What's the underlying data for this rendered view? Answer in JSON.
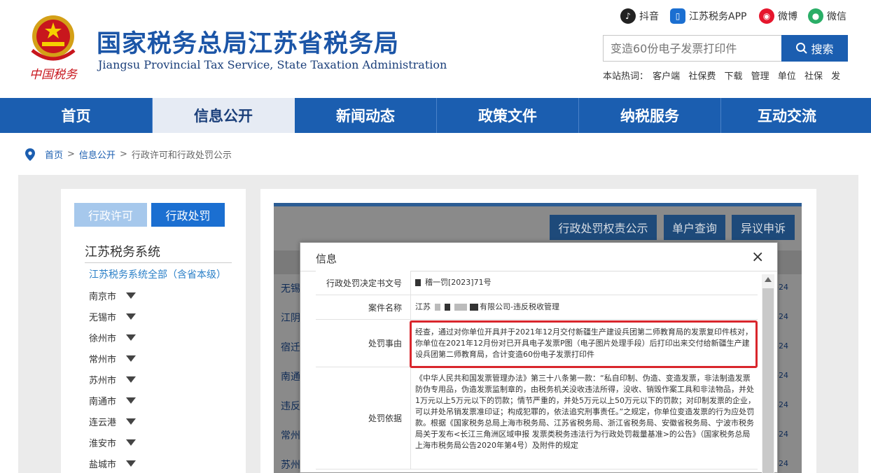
{
  "header": {
    "logo_caption": "中国税务",
    "title": "国家税务总局江苏省税务局",
    "subtitle": "Jiangsu Provincial Tax Service, State Taxation Administration",
    "social": [
      {
        "label": "抖音",
        "icon": "douyin-icon",
        "color": "#222222"
      },
      {
        "label": "江苏税务APP",
        "icon": "app-icon",
        "color": "#1b6fd1"
      },
      {
        "label": "微博",
        "icon": "weibo-icon",
        "color": "#e6162d"
      },
      {
        "label": "微信",
        "icon": "wechat-icon",
        "color": "#2aae67"
      }
    ],
    "search": {
      "placeholder": "变造60份电子发票打印件",
      "button": "搜索"
    },
    "hot_label": "本站热词：",
    "hot_words": [
      "客户端",
      "社保费",
      "下载",
      "管理",
      "单位",
      "社保",
      "发"
    ]
  },
  "nav": [
    "首页",
    "信息公开",
    "新闻动态",
    "政策文件",
    "纳税服务",
    "互动交流"
  ],
  "breadcrumb": {
    "home": "首页",
    "sep": ">",
    "section": "信息公开",
    "current": "行政许可和行政处罚公示"
  },
  "sidebar": {
    "tabs": [
      "行政许可",
      "行政处罚"
    ],
    "title": "江苏税务系统",
    "all": "江苏税务系统全部（含省本级）",
    "cities": [
      "南京市",
      "无锡市",
      "徐州市",
      "常州市",
      "苏州市",
      "南通市",
      "连云港",
      "淮安市",
      "盐城市"
    ]
  },
  "main": {
    "buttons": [
      "行政处罚权责公示",
      "单户查询",
      "异议申诉"
    ],
    "rows": [
      "无锡",
      "江阴",
      "宿迁",
      "南通",
      "违反",
      "常州",
      "苏州"
    ],
    "date_suffix": "-24"
  },
  "dialog": {
    "title": "信息",
    "close": "×",
    "fields": [
      {
        "label": "行政处罚决定书文号",
        "value": "稽一罚[2023]71号"
      },
      {
        "label": "案件名称",
        "value_prefix": "江苏",
        "value_suffix": "有限公司-违反税收管理"
      },
      {
        "label": "处罚事由",
        "value": "经查，通过对你单位开具并于2021年12月交付新疆生产建设兵团第二师教育局的发票复印件核对，你单位在2021年12月份对已开具电子发票P图（电子图片处理手段）后打印出来交付给新疆生产建设兵团第二师教育局，合计变造60份电子发票打印件"
      },
      {
        "label": "处罚依据",
        "value": "《中华人民共和国发票管理办法》第三十八条第一款：“私自印制、伪造、变造发票，非法制造发票防伪专用品，伪造发票监制章的，由税务机关没收违法所得，没收、销毁作案工具和非法物品，并处1万元以上5万元以下的罚款；情节严重的，并处5万元以上50万元以下的罚款；对印制发票的企业，可以并处吊销发票准印证；构成犯罪的，依法追究刑事责任。”之规定，你单位变造发票的行为应处罚款。根据《国家税务总局上海市税务局、江苏省税务局、浙江省税务局、安徽省税务局、宁波市税务局关于发布<长江三角洲区域申报 发票类税务违法行为行政处罚裁量基准>的公告》（国家税务总局上海市税务局公告2020年第4号）及附件的规定"
      }
    ]
  },
  "colors": {
    "brand": "#1b5eb0",
    "highlight": "#d9262c"
  }
}
